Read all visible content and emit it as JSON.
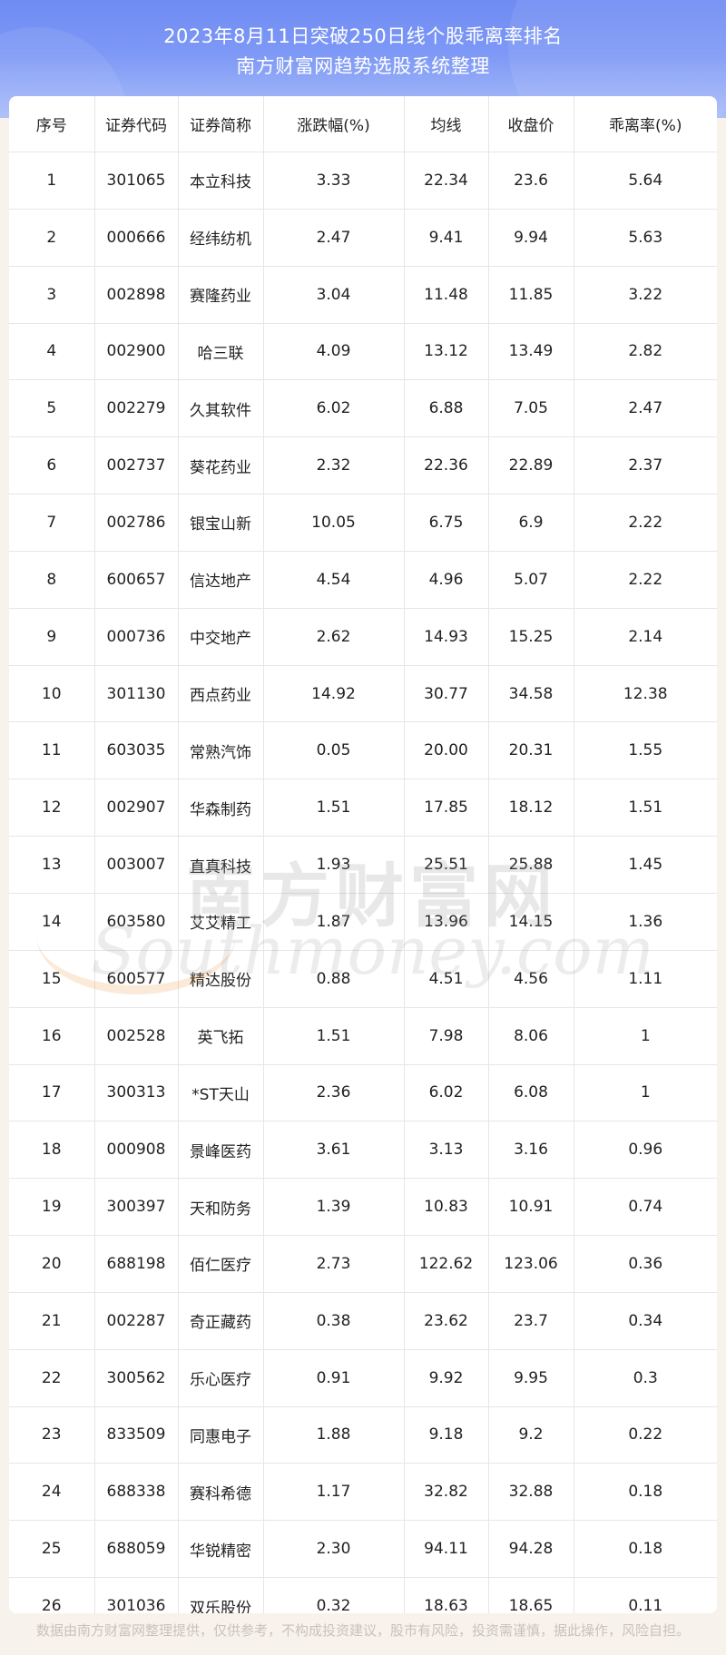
{
  "title": {
    "line1": "2023年8月11日突破250日线个股乖离率排名",
    "line2": "南方财富网趋势选股系统整理"
  },
  "table": {
    "headers": [
      "序号",
      "证券代码",
      "证券简称",
      "涨跌幅(%)",
      "均线",
      "收盘价",
      "乖离率(%)"
    ],
    "rows": [
      [
        "1",
        "301065",
        "本立科技",
        "3.33",
        "22.34",
        "23.6",
        "5.64"
      ],
      [
        "2",
        "000666",
        "经纬纺机",
        "2.47",
        "9.41",
        "9.94",
        "5.63"
      ],
      [
        "3",
        "002898",
        "赛隆药业",
        "3.04",
        "11.48",
        "11.85",
        "3.22"
      ],
      [
        "4",
        "002900",
        "哈三联",
        "4.09",
        "13.12",
        "13.49",
        "2.82"
      ],
      [
        "5",
        "002279",
        "久其软件",
        "6.02",
        "6.88",
        "7.05",
        "2.47"
      ],
      [
        "6",
        "002737",
        "葵花药业",
        "2.32",
        "22.36",
        "22.89",
        "2.37"
      ],
      [
        "7",
        "002786",
        "银宝山新",
        "10.05",
        "6.75",
        "6.9",
        "2.22"
      ],
      [
        "8",
        "600657",
        "信达地产",
        "4.54",
        "4.96",
        "5.07",
        "2.22"
      ],
      [
        "9",
        "000736",
        "中交地产",
        "2.62",
        "14.93",
        "15.25",
        "2.14"
      ],
      [
        "10",
        "301130",
        "西点药业",
        "14.92",
        "30.77",
        "34.58",
        "12.38"
      ],
      [
        "11",
        "603035",
        "常熟汽饰",
        "0.05",
        "20.00",
        "20.31",
        "1.55"
      ],
      [
        "12",
        "002907",
        "华森制药",
        "1.51",
        "17.85",
        "18.12",
        "1.51"
      ],
      [
        "13",
        "003007",
        "直真科技",
        "1.93",
        "25.51",
        "25.88",
        "1.45"
      ],
      [
        "14",
        "603580",
        "艾艾精工",
        "1.87",
        "13.96",
        "14.15",
        "1.36"
      ],
      [
        "15",
        "600577",
        "精达股份",
        "0.88",
        "4.51",
        "4.56",
        "1.11"
      ],
      [
        "16",
        "002528",
        "英飞拓",
        "1.51",
        "7.98",
        "8.06",
        "1"
      ],
      [
        "17",
        "300313",
        "*ST天山",
        "2.36",
        "6.02",
        "6.08",
        "1"
      ],
      [
        "18",
        "000908",
        "景峰医药",
        "3.61",
        "3.13",
        "3.16",
        "0.96"
      ],
      [
        "19",
        "300397",
        "天和防务",
        "1.39",
        "10.83",
        "10.91",
        "0.74"
      ],
      [
        "20",
        "688198",
        "佰仁医疗",
        "2.73",
        "122.62",
        "123.06",
        "0.36"
      ],
      [
        "21",
        "002287",
        "奇正藏药",
        "0.38",
        "23.62",
        "23.7",
        "0.34"
      ],
      [
        "22",
        "300562",
        "乐心医疗",
        "0.91",
        "9.92",
        "9.95",
        "0.3"
      ],
      [
        "23",
        "833509",
        "同惠电子",
        "1.88",
        "9.18",
        "9.2",
        "0.22"
      ],
      [
        "24",
        "688338",
        "赛科希德",
        "1.17",
        "32.82",
        "32.88",
        "0.18"
      ],
      [
        "25",
        "688059",
        "华锐精密",
        "2.30",
        "94.11",
        "94.28",
        "0.18"
      ],
      [
        "26",
        "301036",
        "双乐股份",
        "0.32",
        "18.63",
        "18.65",
        "0.11"
      ]
    ]
  },
  "watermark": {
    "cn": "南方财富网",
    "en": "Southmoney.com"
  },
  "footer": "数据由南方财富网整理提供，仅供参考，不构成投资建议，股市有风险，投资需谨慎，据此操作，风险自担。",
  "colors": {
    "header_top": "#6f8cf3",
    "header_bottom": "#aabdf8",
    "page_bg": "#f7f2ec",
    "grid": "#e6e6e6"
  }
}
